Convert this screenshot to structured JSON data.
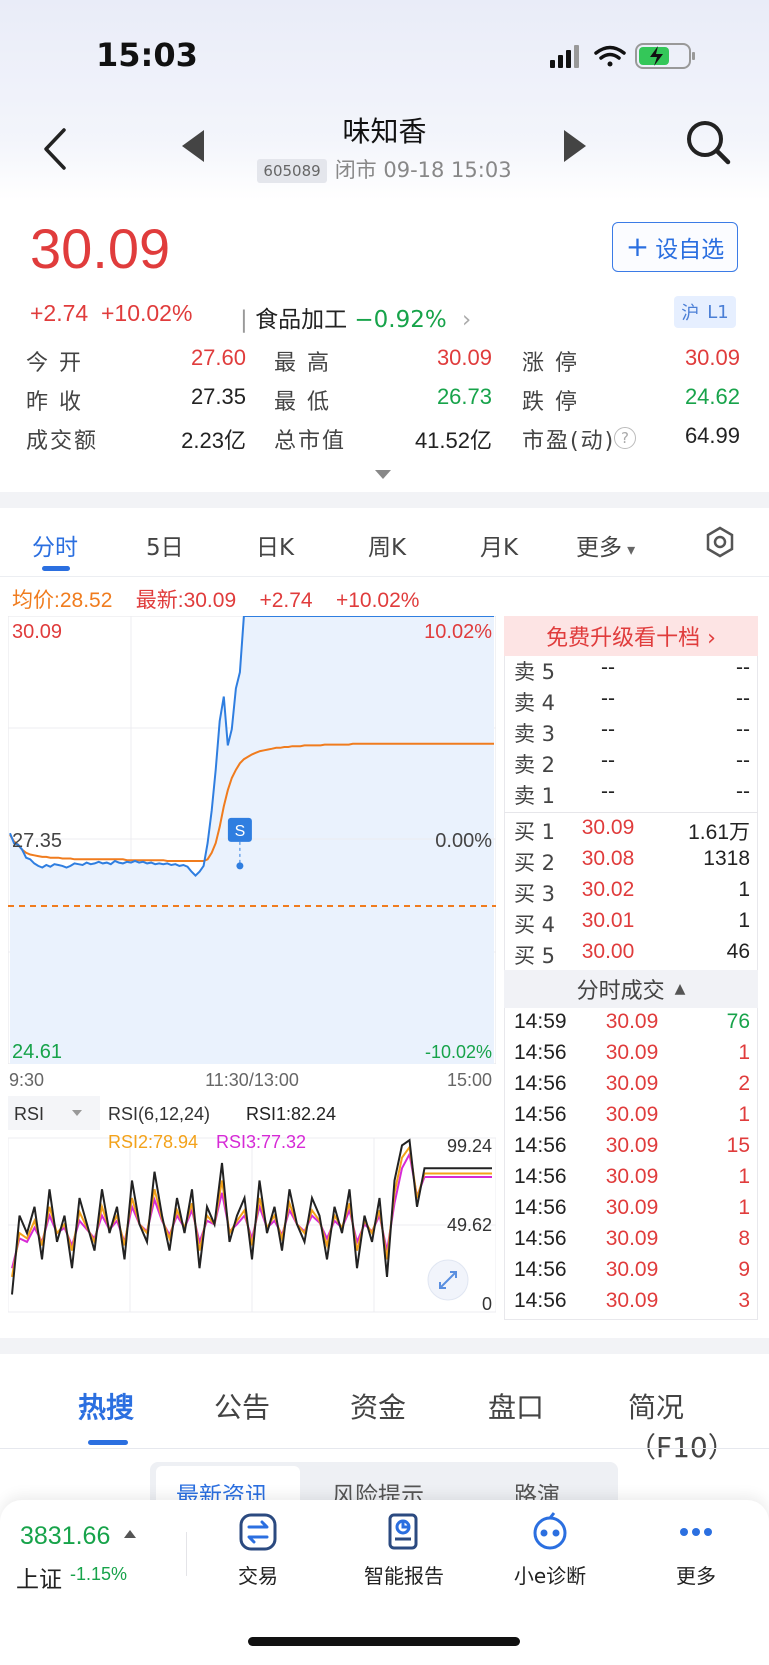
{
  "status": {
    "time": "15:03"
  },
  "header": {
    "stock_name": "味知香",
    "code": "605089",
    "status_text": "闭市 09-18 15:03"
  },
  "quote": {
    "price": "30.09",
    "change": "+2.74",
    "change_pct": "+10.02%",
    "industry_name": "食品加工",
    "industry_change": "−0.92%",
    "watch_label": "设自选",
    "market_badge": [
      "沪",
      "L1"
    ]
  },
  "stats": [
    [
      {
        "label": "今 开",
        "value": "27.60",
        "color": "red"
      },
      {
        "label": "最 高",
        "value": "30.09",
        "color": "red"
      },
      {
        "label": "涨 停",
        "value": "30.09",
        "color": "red"
      }
    ],
    [
      {
        "label": "昨 收",
        "value": "27.35",
        "color": "dark"
      },
      {
        "label": "最 低",
        "value": "26.73",
        "color": "green"
      },
      {
        "label": "跌 停",
        "value": "24.62",
        "color": "green"
      }
    ],
    [
      {
        "label": "成交额",
        "value": "2.23亿",
        "color": "dark"
      },
      {
        "label": "总市值",
        "value": "41.52亿",
        "color": "dark"
      },
      {
        "label": "市盈(动)",
        "value": "64.99",
        "color": "dark"
      }
    ]
  ],
  "chart_tabs": [
    "分时",
    "5日",
    "日K",
    "周K",
    "月K",
    "更多"
  ],
  "legend": {
    "avg": "均价:28.52",
    "latest": "最新:30.09",
    "change": "+2.74",
    "pct": "+10.02%"
  },
  "chart_data": [
    {
      "type": "line",
      "title": "分时",
      "y_left_labels": [
        "30.09",
        "27.35",
        "24.61"
      ],
      "y_right_labels": [
        "10.02%",
        "0.00%",
        "-10.02%"
      ],
      "x_labels": [
        "9:30",
        "11:30/13:00",
        "15:00"
      ],
      "ylim": [
        24.61,
        30.09
      ],
      "prev_close": 27.35,
      "marker": "S",
      "colors": {
        "price": "#2f7ee0",
        "avg": "#f07c1e",
        "area": "#eaf2fd"
      },
      "series": [
        {
          "name": "最新",
          "color": "#2f7ee0",
          "x": [
            0,
            2,
            4,
            6,
            8,
            10,
            12,
            14,
            16,
            18,
            20,
            22,
            24,
            26,
            28,
            30,
            32,
            34,
            36,
            38,
            40,
            42,
            44,
            46,
            48,
            50,
            52,
            54,
            56,
            58,
            60,
            62,
            64,
            66,
            68,
            70,
            72,
            74,
            76,
            78,
            80,
            82,
            84,
            86,
            88,
            90,
            92,
            94,
            96,
            98,
            100,
            102,
            104,
            106,
            108,
            110,
            112,
            114,
            116,
            118,
            120,
            122,
            124,
            126,
            128,
            130,
            132,
            134,
            136,
            138,
            140,
            142,
            144,
            146,
            148,
            150,
            152,
            154,
            156,
            158,
            160,
            162,
            164,
            166,
            168,
            170,
            172,
            174,
            176,
            178,
            180,
            182,
            184,
            186,
            188,
            190,
            192,
            194,
            196,
            198,
            200,
            202,
            204,
            206,
            208,
            210,
            212,
            214,
            216,
            218,
            220,
            222,
            224,
            226,
            228,
            230,
            232,
            234,
            236,
            238,
            240
          ],
          "values": [
            27.42,
            27.3,
            27.28,
            27.22,
            27.12,
            27.1,
            27.05,
            27.02,
            27.0,
            27.03,
            27.01,
            27.04,
            27.03,
            27.02,
            27.0,
            27.02,
            27.05,
            27.04,
            27.03,
            27.06,
            27.04,
            27.05,
            27.07,
            27.05,
            27.06,
            27.04,
            27.08,
            27.06,
            27.05,
            27.07,
            27.06,
            27.08,
            27.06,
            27.07,
            27.05,
            27.06,
            27.04,
            27.05,
            27.04,
            27.05,
            27.03,
            27.04,
            27.02,
            27.03,
            27.01,
            26.95,
            26.9,
            26.95,
            27.02,
            27.3,
            27.7,
            28.2,
            28.8,
            29.1,
            28.5,
            28.7,
            29.2,
            29.4,
            30.09,
            30.09,
            30.09,
            30.09,
            30.09,
            30.09,
            30.09,
            30.09,
            30.09,
            30.09,
            30.09,
            30.09,
            30.09,
            30.09,
            30.09,
            30.09,
            30.09,
            30.09,
            30.09,
            30.09,
            30.09,
            30.09,
            30.09,
            30.09,
            30.09,
            30.09,
            30.09,
            30.09,
            30.09,
            30.09,
            30.09,
            30.09,
            30.09,
            30.09,
            30.09,
            30.09,
            30.09,
            30.09,
            30.09,
            30.09,
            30.09,
            30.09,
            30.09,
            30.09,
            30.09,
            30.09,
            30.09,
            30.09,
            30.09,
            30.09,
            30.09,
            30.09,
            30.09,
            30.09,
            30.09,
            30.09,
            30.09,
            30.09,
            30.09,
            30.09,
            30.09,
            30.09,
            30.09
          ]
        },
        {
          "name": "均价",
          "color": "#f07c1e",
          "x": [
            0,
            2,
            4,
            6,
            8,
            10,
            12,
            14,
            16,
            18,
            20,
            22,
            24,
            26,
            28,
            30,
            32,
            34,
            36,
            38,
            40,
            42,
            44,
            46,
            48,
            50,
            52,
            54,
            56,
            58,
            60,
            62,
            64,
            66,
            68,
            70,
            72,
            74,
            76,
            78,
            80,
            82,
            84,
            86,
            88,
            90,
            92,
            94,
            96,
            98,
            100,
            102,
            104,
            106,
            108,
            110,
            112,
            114,
            116,
            118,
            120,
            122,
            124,
            126,
            128,
            130,
            132,
            134,
            136,
            138,
            140,
            142,
            144,
            146,
            148,
            150,
            152,
            154,
            156,
            158,
            160,
            162,
            164,
            166,
            168,
            170,
            172,
            174,
            176,
            178,
            180,
            182,
            184,
            186,
            188,
            190,
            192,
            194,
            196,
            198,
            200,
            202,
            204,
            206,
            208,
            210,
            212,
            214,
            216,
            218,
            220,
            222,
            224,
            226,
            228,
            230,
            232,
            234,
            236,
            238,
            240
          ],
          "values": [
            27.4,
            27.32,
            27.28,
            27.22,
            27.18,
            27.16,
            27.15,
            27.14,
            27.13,
            27.13,
            27.12,
            27.12,
            27.12,
            27.11,
            27.11,
            27.11,
            27.1,
            27.1,
            27.1,
            27.1,
            27.1,
            27.1,
            27.1,
            27.1,
            27.1,
            27.1,
            27.1,
            27.1,
            27.1,
            27.09,
            27.09,
            27.09,
            27.09,
            27.09,
            27.09,
            27.09,
            27.09,
            27.09,
            27.09,
            27.08,
            27.08,
            27.08,
            27.08,
            27.08,
            27.08,
            27.08,
            27.08,
            27.08,
            27.08,
            27.1,
            27.18,
            27.3,
            27.5,
            27.75,
            27.95,
            28.1,
            28.2,
            28.28,
            28.33,
            28.36,
            28.39,
            28.41,
            28.43,
            28.44,
            28.45,
            28.46,
            28.47,
            28.47,
            28.48,
            28.48,
            28.49,
            28.49,
            28.49,
            28.5,
            28.5,
            28.5,
            28.5,
            28.5,
            28.51,
            28.51,
            28.51,
            28.51,
            28.51,
            28.51,
            28.51,
            28.52,
            28.52,
            28.52,
            28.52,
            28.52,
            28.52,
            28.52,
            28.52,
            28.52,
            28.52,
            28.52,
            28.52,
            28.52,
            28.52,
            28.52,
            28.52,
            28.52,
            28.52,
            28.52,
            28.52,
            28.52,
            28.52,
            28.52,
            28.52,
            28.52,
            28.52,
            28.52,
            28.52,
            28.52,
            28.52,
            28.52,
            28.52,
            28.52,
            28.52,
            28.52,
            28.52
          ]
        }
      ]
    },
    {
      "type": "line",
      "title": "RSI",
      "selector": "RSI",
      "params": "RSI(6,12,24)",
      "labels": [
        "RSI1:82.24",
        "RSI2:78.94",
        "RSI3:77.32"
      ],
      "y_labels": [
        "99.24",
        "49.62",
        "0"
      ],
      "ylim": [
        0,
        99.24
      ],
      "series": [
        {
          "name": "RSI1",
          "color": "#222222",
          "values": [
            10,
            55,
            45,
            60,
            30,
            70,
            40,
            55,
            25,
            65,
            50,
            35,
            70,
            45,
            60,
            30,
            75,
            50,
            40,
            80,
            55,
            35,
            65,
            45,
            70,
            25,
            60,
            50,
            85,
            40,
            55,
            65,
            30,
            75,
            45,
            60,
            35,
            70,
            50,
            40,
            65,
            55,
            30,
            60,
            45,
            70,
            25,
            55,
            40,
            65,
            20,
            75,
            95,
            98,
            60,
            82,
            82,
            82,
            82,
            82,
            82,
            82,
            82,
            82,
            82
          ]
        },
        {
          "name": "RSI2",
          "color": "#f3a21a",
          "values": [
            20,
            45,
            42,
            52,
            38,
            60,
            45,
            50,
            35,
            57,
            48,
            40,
            60,
            47,
            55,
            38,
            65,
            50,
            45,
            70,
            53,
            42,
            58,
            48,
            62,
            35,
            55,
            50,
            75,
            45,
            52,
            58,
            38,
            65,
            48,
            55,
            42,
            62,
            50,
            45,
            58,
            52,
            38,
            55,
            48,
            62,
            35,
            52,
            45,
            58,
            30,
            68,
            88,
            94,
            65,
            79,
            79,
            79,
            79,
            79,
            79,
            79,
            79,
            79,
            79
          ]
        },
        {
          "name": "RSI3",
          "color": "#d62ad6",
          "values": [
            25,
            42,
            40,
            48,
            40,
            55,
            45,
            48,
            38,
            52,
            47,
            42,
            55,
            47,
            52,
            40,
            60,
            50,
            46,
            64,
            52,
            44,
            55,
            48,
            58,
            40,
            52,
            50,
            68,
            46,
            50,
            55,
            42,
            60,
            48,
            52,
            44,
            58,
            50,
            46,
            55,
            51,
            42,
            52,
            48,
            58,
            40,
            50,
            46,
            55,
            35,
            62,
            82,
            90,
            66,
            77,
            77,
            77,
            77,
            77,
            77,
            77,
            77,
            77,
            77
          ]
        }
      ]
    }
  ],
  "orderbook": {
    "upgrade": "免费升级看十档 ›",
    "sells": [
      {
        "label": "卖 5",
        "price": "--",
        "vol": "--"
      },
      {
        "label": "卖 4",
        "price": "--",
        "vol": "--"
      },
      {
        "label": "卖 3",
        "price": "--",
        "vol": "--"
      },
      {
        "label": "卖 2",
        "price": "--",
        "vol": "--"
      },
      {
        "label": "卖 1",
        "price": "--",
        "vol": "--"
      }
    ],
    "buys": [
      {
        "label": "买 1",
        "price": "30.09",
        "vol": "1.61万"
      },
      {
        "label": "买 2",
        "price": "30.08",
        "vol": "1318"
      },
      {
        "label": "买 3",
        "price": "30.02",
        "vol": "1"
      },
      {
        "label": "买 4",
        "price": "30.01",
        "vol": "1"
      },
      {
        "label": "买 5",
        "price": "30.00",
        "vol": "46"
      }
    ],
    "ticks_header": "分时成交",
    "ticks": [
      {
        "time": "14:59",
        "price": "30.09",
        "vol": "76"
      },
      {
        "time": "14:56",
        "price": "30.09",
        "vol": "1"
      },
      {
        "time": "14:56",
        "price": "30.09",
        "vol": "2"
      },
      {
        "time": "14:56",
        "price": "30.09",
        "vol": "1"
      },
      {
        "time": "14:56",
        "price": "30.09",
        "vol": "15"
      },
      {
        "time": "14:56",
        "price": "30.09",
        "vol": "1"
      },
      {
        "time": "14:56",
        "price": "30.09",
        "vol": "1"
      },
      {
        "time": "14:56",
        "price": "30.09",
        "vol": "8"
      },
      {
        "time": "14:56",
        "price": "30.09",
        "vol": "9"
      },
      {
        "time": "14:56",
        "price": "30.09",
        "vol": "3"
      }
    ]
  },
  "news_tabs": [
    "热搜",
    "公告",
    "资金",
    "盘口",
    "简况（F10）"
  ],
  "segments": [
    "最新资讯",
    "风险提示",
    "路演"
  ],
  "bottom": {
    "index_value": "3831.66",
    "index_name": "上证",
    "index_change": "-1.15%",
    "actions": [
      "交易",
      "智能报告",
      "小e诊断",
      "更多"
    ]
  },
  "colors": {
    "up": "#e03c3c",
    "down": "#17a34a",
    "accent": "#2b6fe0"
  }
}
